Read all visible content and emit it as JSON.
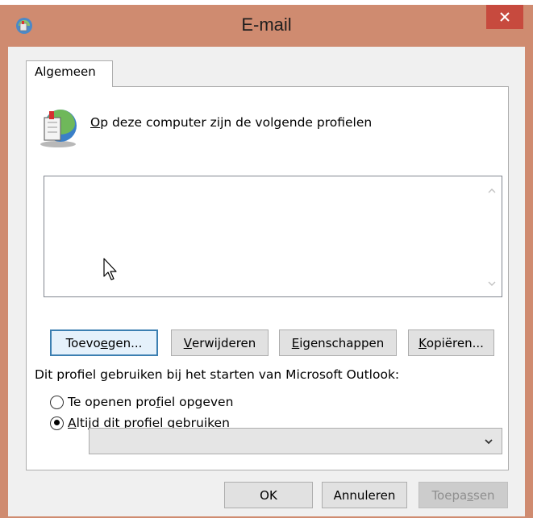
{
  "window": {
    "title": "E-mail"
  },
  "tab": {
    "label": "Algemeen"
  },
  "heading": {
    "accel": "O",
    "rest": "p deze computer zijn de volgende profielen"
  },
  "profiles_list": {
    "items": []
  },
  "buttons": {
    "add": {
      "pre": "Toevo",
      "accel": "e",
      "post": "gen..."
    },
    "remove": {
      "pre": "",
      "accel": "V",
      "post": "erwijderen"
    },
    "properties": {
      "pre": "",
      "accel": "E",
      "post": "igenschappen"
    },
    "copy": {
      "pre": "",
      "accel": "K",
      "post": "opiëren..."
    }
  },
  "startup_label": "Dit profiel gebruiken bij het starten van Microsoft Outlook:",
  "radios": {
    "prompt": {
      "pre": "Te openen pro",
      "accel": "f",
      "post": "iel opgeven",
      "checked": false
    },
    "always": {
      "pre": "",
      "accel": "A",
      "post": "ltijd dit profiel gebruiken",
      "checked": true
    }
  },
  "profile_combo": {
    "value": ""
  },
  "footer": {
    "ok": "OK",
    "cancel": "Annuleren",
    "apply": {
      "pre": "Toepa",
      "accel": "s",
      "post": "sen"
    }
  },
  "colors": {
    "title_bar": "#cf8b70",
    "close_button": "#c74a3e",
    "default_button_border": "#3c7fb1"
  }
}
